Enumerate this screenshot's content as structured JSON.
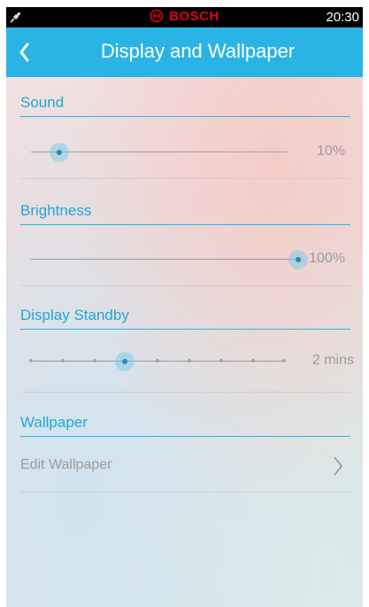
{
  "status_bar": {
    "plug_icon": "power-plug-icon",
    "brand": "BOSCH",
    "brand_color": "#e2001a",
    "time": "20:30"
  },
  "app_bar": {
    "back_icon": "chevron-left-icon",
    "title": "Display and Wallpaper",
    "color": "#2ab4e5"
  },
  "sound": {
    "header": "Sound",
    "level_percent": 10,
    "value_text": "10%"
  },
  "brightness": {
    "header": "Brightness",
    "level_percent": 100,
    "value_text": "100%"
  },
  "display_standby": {
    "header": "Display Standby",
    "step_count": 9,
    "selected_step": 4,
    "value_text": "2 mins"
  },
  "wallpaper": {
    "header": "Wallpaper",
    "edit_label": "Edit Wallpaper",
    "chevron_icon": "chevron-right-icon"
  }
}
